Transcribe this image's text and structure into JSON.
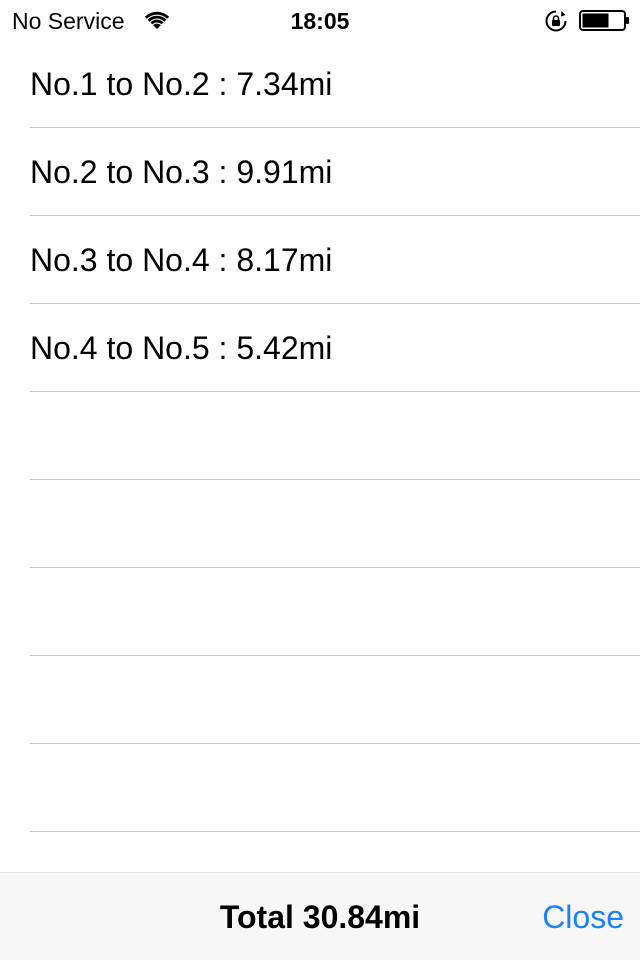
{
  "status_bar": {
    "carrier": "No Service",
    "time": "18:05",
    "icons": {
      "wifi": "wifi-icon",
      "rotation_lock": "rotation-lock-icon",
      "battery": "battery-icon"
    },
    "battery_level": 0.65
  },
  "route_list": {
    "rows": [
      {
        "label": "No.1 to No.2 : 7.34mi"
      },
      {
        "label": "No.2 to No.3 : 9.91mi"
      },
      {
        "label": "No.3 to No.4 : 8.17mi"
      },
      {
        "label": "No.4 to No.5 : 5.42mi"
      },
      {
        "label": ""
      },
      {
        "label": ""
      },
      {
        "label": ""
      },
      {
        "label": ""
      },
      {
        "label": ""
      },
      {
        "label": ""
      }
    ],
    "separator_color": "#c8c7cc"
  },
  "toolbar": {
    "total_label": "Total 30.84mi",
    "close_label": "Close",
    "accent_color": "#1a82fb",
    "background_color": "#f7f7f7"
  }
}
